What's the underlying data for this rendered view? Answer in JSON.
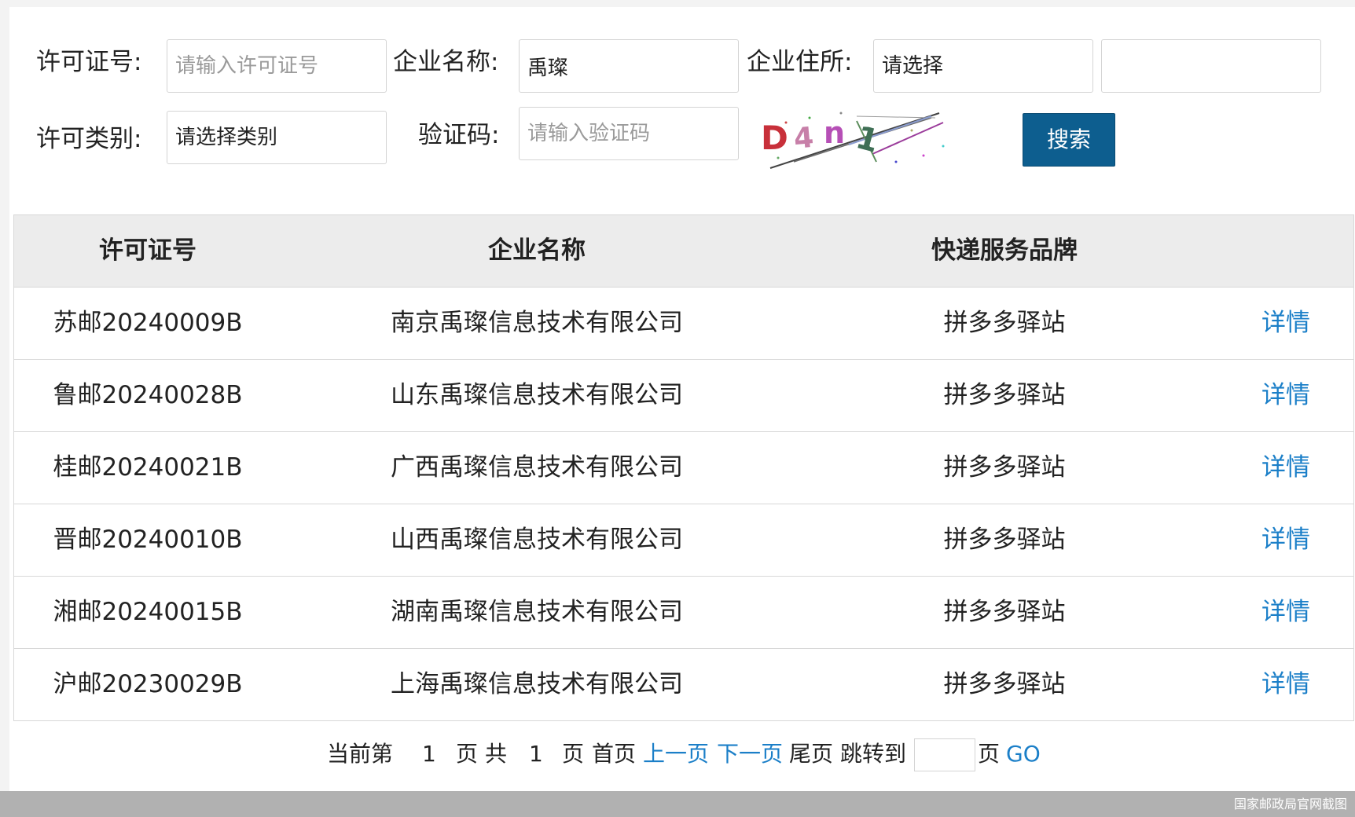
{
  "search_form": {
    "license_no_label": "许可证号:",
    "license_no_placeholder": "请输入许可证号",
    "company_name_label": "企业名称:",
    "company_name_value": "禹璨",
    "address_label": "企业住所:",
    "address_select_value": "请选择",
    "address_select_2_value": "",
    "category_label": "许可类别:",
    "category_select_value": "请选择类别",
    "captcha_label": "验证码:",
    "captcha_placeholder": "请输入验证码",
    "captcha_image_text": "D4n1",
    "search_button": "搜索"
  },
  "table": {
    "headers": [
      "许可证号",
      "企业名称",
      "快递服务品牌",
      ""
    ],
    "rows": [
      {
        "license_no": "苏邮20240009B",
        "company": "南京禹璨信息技术有限公司",
        "brand": "拼多多驿站",
        "action": "详情"
      },
      {
        "license_no": "鲁邮20240028B",
        "company": "山东禹璨信息技术有限公司",
        "brand": "拼多多驿站",
        "action": "详情"
      },
      {
        "license_no": "桂邮20240021B",
        "company": "广西禹璨信息技术有限公司",
        "brand": "拼多多驿站",
        "action": "详情"
      },
      {
        "license_no": "晋邮20240010B",
        "company": "山西禹璨信息技术有限公司",
        "brand": "拼多多驿站",
        "action": "详情"
      },
      {
        "license_no": "湘邮20240015B",
        "company": "湖南禹璨信息技术有限公司",
        "brand": "拼多多驿站",
        "action": "详情"
      },
      {
        "license_no": "沪邮20230029B",
        "company": "上海禹璨信息技术有限公司",
        "brand": "拼多多驿站",
        "action": "详情"
      }
    ]
  },
  "pagination": {
    "current_prefix": "当前第",
    "current_page": "1",
    "page_word": "页",
    "total_prefix": "共",
    "total_pages": "1",
    "page_word_2": "页",
    "first": "首页",
    "prev": "上一页",
    "next": "下一页",
    "last": "尾页",
    "jump_to": "跳转到",
    "jump_value": "",
    "page_word_3": "页",
    "go": "GO"
  },
  "watermark": "国家邮政局官网截图",
  "colors": {
    "primary_button": "#0d5e8f",
    "link": "#1b7fc8",
    "header_bg": "#ececec"
  }
}
